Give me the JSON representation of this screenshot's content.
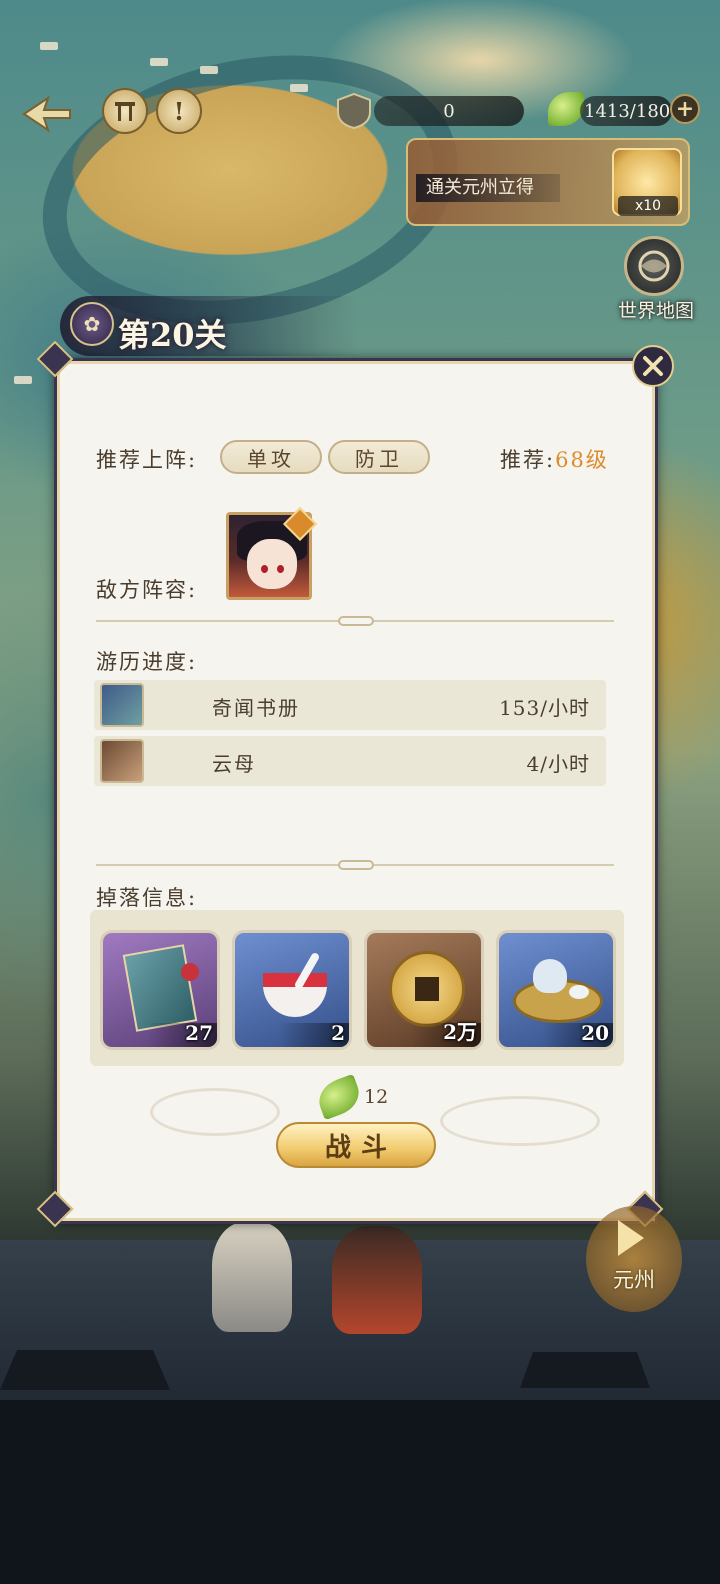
{
  "resources": {
    "currency_value": "0",
    "stamina_value": "1413/180",
    "plus_label": "+"
  },
  "top": {
    "info_label": "!"
  },
  "reward_banner": {
    "text": "通关元州立得",
    "item_count": "x10"
  },
  "world_map": {
    "label": "世界地图"
  },
  "stage": {
    "title": "第20关"
  },
  "dialog": {
    "recommend_label": "推荐上阵:",
    "recommend_tags": [
      "单攻",
      "防卫"
    ],
    "recommend_level_label": "推荐:",
    "recommend_level_value": "68级",
    "enemy_label": "敌方阵容:",
    "progress_label": "游历进度:",
    "progress_items": [
      {
        "name": "奇闻书册",
        "rate": "153/小时",
        "icon": "green-book-icon"
      },
      {
        "name": "云母",
        "rate": "4/小时",
        "icon": "mica-bowl-icon"
      }
    ],
    "drops_label": "掉落信息:",
    "drops": [
      {
        "count": "27",
        "icon": "book-with-flowers-icon",
        "rarity_color": "#7a5a9a"
      },
      {
        "count": "2",
        "icon": "red-powder-bowl-icon",
        "rarity_color": "#4a6aa8"
      },
      {
        "count": "2万",
        "icon": "copper-coin-icon",
        "rarity_color": "#7a5a3a"
      },
      {
        "count": "20",
        "icon": "tea-set-icon",
        "rarity_color": "#4a6aa8"
      }
    ],
    "cost_value": "12",
    "fight_label": "战斗"
  },
  "next_region": {
    "label": "元州"
  },
  "colors": {
    "accent_orange": "#e08a2e",
    "panel_bg": "#f6f4ee",
    "frame_dark": "#3b3450",
    "gold": "#d9a443"
  }
}
